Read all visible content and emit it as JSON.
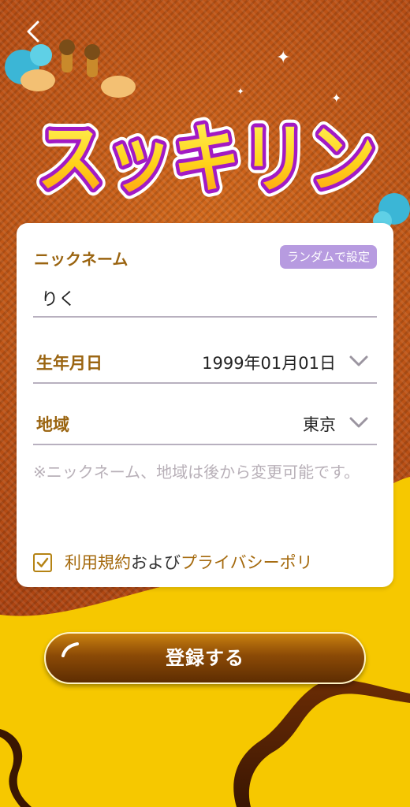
{
  "logo": {
    "text": "スッキリン"
  },
  "form": {
    "nickname": {
      "label": "ニックネーム",
      "random_button": "ランダムで設定",
      "value": "りく"
    },
    "birthdate": {
      "label": "生年月日",
      "value": "1999年01月01日"
    },
    "region": {
      "label": "地域",
      "value": "東京"
    },
    "note": "※ニックネーム、地域は後から変更可能です。",
    "agreement": {
      "checked": true,
      "terms_link": "利用規約",
      "middle_text": "および",
      "privacy_link": "プライバシーポリ"
    }
  },
  "register_button": "登録する",
  "colors": {
    "accent_label": "#9a6410",
    "random_button_bg": "#b79be0",
    "background_top": "#b34a12",
    "background_bottom": "#f6c800"
  },
  "icons": {
    "back": "chevron-left-icon",
    "dropdown": "chevron-down-icon",
    "check": "checkmark-icon"
  }
}
